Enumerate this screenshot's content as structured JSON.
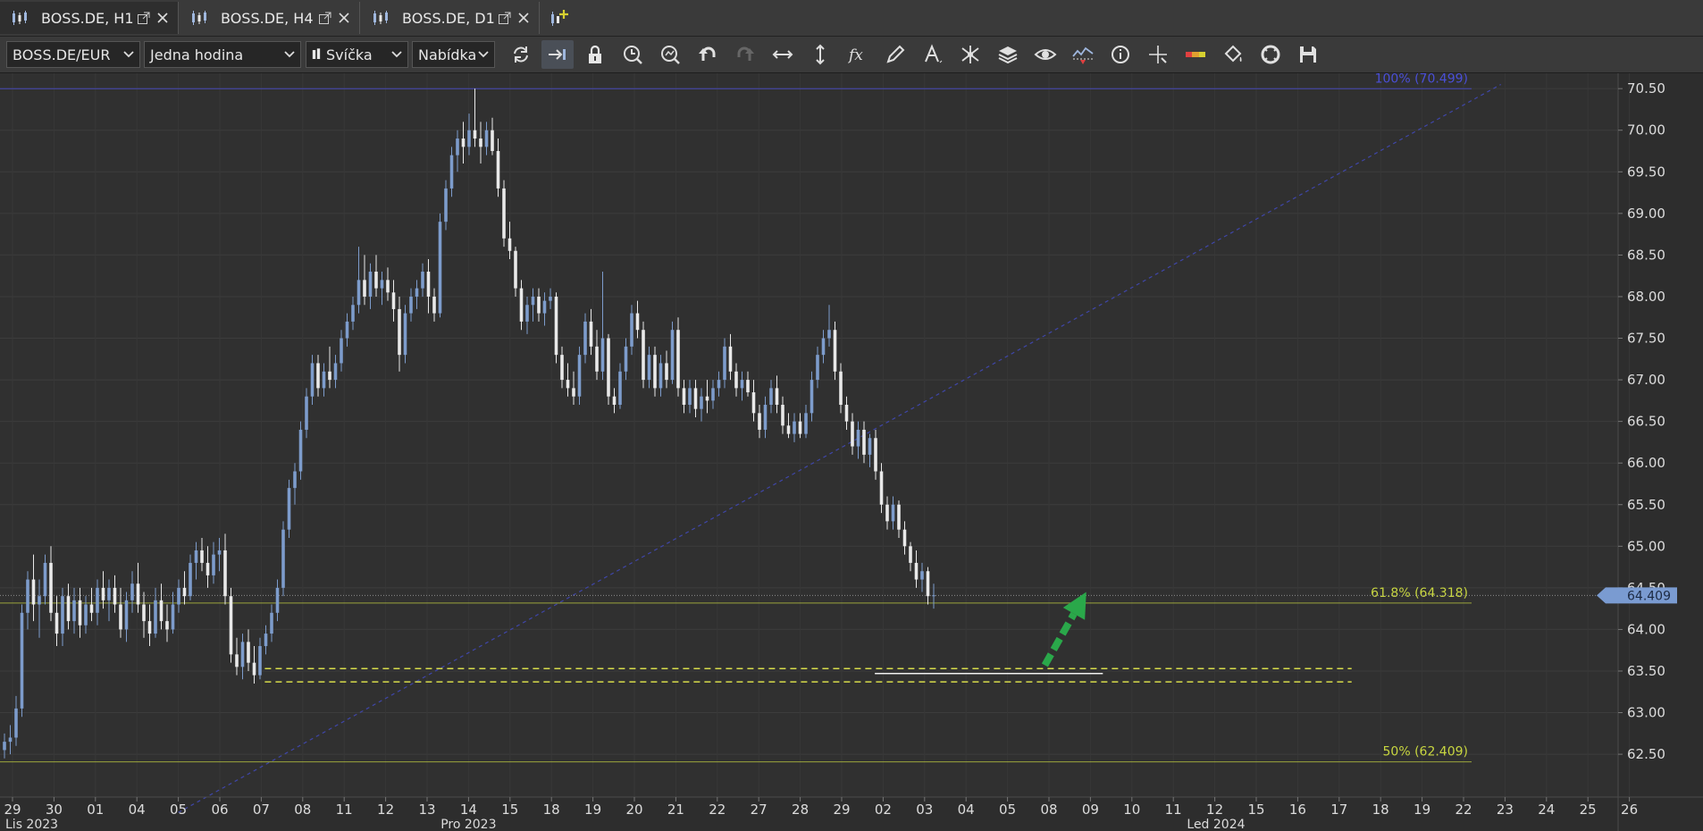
{
  "tabs": [
    {
      "label": "BOSS.DE, H1",
      "active": true
    },
    {
      "label": "BOSS.DE, H4",
      "active": false
    },
    {
      "label": "BOSS.DE, D1",
      "active": false
    }
  ],
  "toolbar": {
    "symbol": "BOSS.DE/EUR",
    "timeframe": "Jedna hodina",
    "chart_type": "Svíčka",
    "price_side": "Nabídka",
    "icons": [
      "refresh-icon",
      "auto-scroll-icon",
      "lock-icon",
      "zoom-time-icon",
      "zoom-fit-icon",
      "undo-icon",
      "redo-icon",
      "horizontal-scale-icon",
      "vertical-scale-icon",
      "indicator-fx-icon",
      "pencil-icon",
      "text-tool-icon",
      "drawing-tools-icon",
      "layers-icon",
      "eye-icon",
      "alert-icon",
      "info-icon",
      "crosshair-icon",
      "color-scale-icon",
      "paint-bucket-icon",
      "fullscreen-icon",
      "save-icon"
    ]
  },
  "colors": {
    "background": "#2d2d2d",
    "bull_candle": "#7d9ccc",
    "bear_candle": "#e9e9e9",
    "fib_100": "#4a4fd6",
    "fib_level": "#c8d640",
    "zone_line": "#d8dc4a",
    "arrow": "#2aa84a",
    "price_tag": "#7a9bd1"
  },
  "chart_data": {
    "type": "candlestick",
    "symbol": "BOSS.DE/EUR",
    "timeframe": "H1",
    "ylim": [
      62.05,
      70.62
    ],
    "y_ticks": [
      "70.50",
      "70.00",
      "69.50",
      "69.00",
      "68.50",
      "68.00",
      "67.50",
      "67.00",
      "66.50",
      "66.00",
      "65.50",
      "65.00",
      "64.50",
      "64.00",
      "63.50",
      "63.00",
      "62.50"
    ],
    "x_ticks": [
      "29",
      "30",
      "01",
      "04",
      "05",
      "06",
      "07",
      "08",
      "11",
      "12",
      "13",
      "14",
      "15",
      "18",
      "19",
      "20",
      "21",
      "22",
      "27",
      "28",
      "29",
      "02",
      "03",
      "04",
      "05",
      "08",
      "09",
      "10",
      "11",
      "12",
      "15",
      "16",
      "17",
      "18",
      "19",
      "22",
      "23",
      "24",
      "25",
      "26"
    ],
    "period_labels": [
      {
        "label": "Lis 2023",
        "at_tick": 0
      },
      {
        "label": "Pro 2023",
        "at_tick": 10.5
      },
      {
        "label": "Led 2024",
        "at_tick": 28.5
      }
    ],
    "current_price": "64.409",
    "fibonacci": [
      {
        "label": "100% (70.499)",
        "value": 70.499
      },
      {
        "label": "61.8% (64.318)",
        "value": 64.318
      },
      {
        "label": "50% (62.409)",
        "value": 62.409
      }
    ],
    "support_zone": {
      "upper": 63.53,
      "lower": 63.37,
      "from_tick": 6,
      "to_tick": 32.3
    },
    "support_line": {
      "value": 63.47,
      "from_tick": 20.8,
      "to_tick": 26.3
    },
    "trendline": {
      "from": {
        "tick": 4.0,
        "value": 61.8
      },
      "to": {
        "tick": 35.9,
        "value": 70.55
      }
    },
    "arrow": {
      "from": {
        "tick": 24.9,
        "value": 63.57
      },
      "to": {
        "tick": 25.9,
        "value": 64.45
      }
    },
    "candles": [
      [
        62.55,
        62.75,
        62.45,
        62.65
      ],
      [
        62.65,
        62.85,
        62.5,
        62.7
      ],
      [
        62.7,
        63.2,
        62.6,
        63.05
      ],
      [
        63.05,
        64.3,
        62.95,
        64.2
      ],
      [
        64.2,
        64.7,
        64.0,
        64.6
      ],
      [
        64.6,
        64.9,
        64.1,
        64.3
      ],
      [
        64.3,
        64.6,
        63.9,
        64.4
      ],
      [
        64.4,
        64.9,
        64.3,
        64.8
      ],
      [
        64.8,
        65.0,
        64.1,
        64.2
      ],
      [
        64.2,
        64.4,
        63.8,
        63.95
      ],
      [
        63.95,
        64.5,
        63.8,
        64.4
      ],
      [
        64.4,
        64.55,
        64.0,
        64.1
      ],
      [
        64.1,
        64.5,
        63.95,
        64.35
      ],
      [
        64.35,
        64.5,
        63.9,
        64.05
      ],
      [
        64.05,
        64.4,
        63.95,
        64.3
      ],
      [
        64.3,
        64.5,
        64.1,
        64.2
      ],
      [
        64.2,
        64.6,
        64.05,
        64.5
      ],
      [
        64.5,
        64.7,
        64.25,
        64.35
      ],
      [
        64.35,
        64.6,
        64.1,
        64.5
      ],
      [
        64.5,
        64.65,
        64.2,
        64.3
      ],
      [
        64.3,
        64.5,
        63.9,
        64.0
      ],
      [
        64.0,
        64.45,
        63.85,
        64.35
      ],
      [
        64.35,
        64.7,
        64.2,
        64.55
      ],
      [
        64.55,
        64.8,
        64.2,
        64.3
      ],
      [
        64.3,
        64.45,
        63.9,
        64.1
      ],
      [
        64.1,
        64.3,
        63.8,
        63.95
      ],
      [
        63.95,
        64.5,
        63.9,
        64.35
      ],
      [
        64.35,
        64.55,
        64.0,
        64.1
      ],
      [
        64.1,
        64.3,
        63.85,
        64.0
      ],
      [
        64.0,
        64.45,
        63.95,
        64.3
      ],
      [
        64.3,
        64.6,
        64.2,
        64.5
      ],
      [
        64.5,
        64.7,
        64.3,
        64.4
      ],
      [
        64.4,
        64.9,
        64.35,
        64.8
      ],
      [
        64.8,
        65.05,
        64.6,
        64.95
      ],
      [
        64.95,
        65.1,
        64.7,
        64.8
      ],
      [
        64.8,
        65.0,
        64.5,
        64.65
      ],
      [
        64.65,
        65.05,
        64.55,
        64.9
      ],
      [
        64.9,
        65.1,
        64.7,
        64.95
      ],
      [
        64.95,
        65.15,
        64.3,
        64.4
      ],
      [
        64.4,
        64.5,
        63.6,
        63.7
      ],
      [
        63.7,
        63.9,
        63.45,
        63.55
      ],
      [
        63.55,
        63.95,
        63.4,
        63.85
      ],
      [
        63.85,
        64.0,
        63.5,
        63.6
      ],
      [
        63.6,
        63.8,
        63.35,
        63.45
      ],
      [
        63.45,
        63.9,
        63.4,
        63.8
      ],
      [
        63.8,
        64.05,
        63.7,
        63.95
      ],
      [
        63.95,
        64.3,
        63.85,
        64.2
      ],
      [
        64.2,
        64.6,
        64.1,
        64.5
      ],
      [
        64.5,
        65.3,
        64.4,
        65.2
      ],
      [
        65.2,
        65.8,
        65.1,
        65.7
      ],
      [
        65.7,
        66.0,
        65.5,
        65.9
      ],
      [
        65.9,
        66.5,
        65.8,
        66.4
      ],
      [
        66.4,
        66.9,
        66.3,
        66.8
      ],
      [
        66.8,
        67.3,
        66.7,
        67.2
      ],
      [
        67.2,
        67.3,
        66.8,
        66.9
      ],
      [
        66.9,
        67.2,
        66.8,
        67.1
      ],
      [
        67.1,
        67.4,
        66.9,
        67.0
      ],
      [
        67.0,
        67.3,
        66.9,
        67.2
      ],
      [
        67.2,
        67.6,
        67.1,
        67.5
      ],
      [
        67.5,
        67.8,
        67.4,
        67.7
      ],
      [
        67.7,
        68.0,
        67.6,
        67.9
      ],
      [
        67.9,
        68.6,
        67.8,
        68.2
      ],
      [
        68.2,
        68.5,
        67.9,
        68.0
      ],
      [
        68.0,
        68.4,
        67.85,
        68.3
      ],
      [
        68.3,
        68.5,
        68.0,
        68.1
      ],
      [
        68.1,
        68.3,
        67.9,
        68.2
      ],
      [
        68.2,
        68.35,
        67.95,
        68.05
      ],
      [
        68.05,
        68.2,
        67.7,
        67.85
      ],
      [
        67.85,
        68.0,
        67.1,
        67.3
      ],
      [
        67.3,
        67.9,
        67.2,
        67.8
      ],
      [
        67.8,
        68.1,
        67.7,
        68.0
      ],
      [
        68.0,
        68.2,
        67.85,
        68.1
      ],
      [
        68.1,
        68.4,
        68.0,
        68.3
      ],
      [
        68.3,
        68.45,
        67.8,
        68.0
      ],
      [
        68.0,
        68.1,
        67.7,
        67.8
      ],
      [
        67.8,
        69.0,
        67.75,
        68.9
      ],
      [
        68.9,
        69.4,
        68.8,
        69.3
      ],
      [
        69.3,
        69.8,
        69.2,
        69.7
      ],
      [
        69.7,
        70.0,
        69.5,
        69.9
      ],
      [
        69.9,
        70.1,
        69.6,
        69.8
      ],
      [
        69.8,
        70.2,
        69.7,
        70.0
      ],
      [
        70.0,
        70.5,
        69.8,
        69.9
      ],
      [
        69.9,
        70.1,
        69.6,
        69.8
      ],
      [
        69.8,
        70.1,
        69.7,
        70.0
      ],
      [
        70.0,
        70.15,
        69.7,
        69.75
      ],
      [
        69.75,
        69.9,
        69.2,
        69.3
      ],
      [
        69.3,
        69.4,
        68.6,
        68.7
      ],
      [
        68.7,
        68.9,
        68.45,
        68.55
      ],
      [
        68.55,
        68.6,
        68.0,
        68.1
      ],
      [
        68.1,
        68.2,
        67.6,
        67.7
      ],
      [
        67.7,
        68.0,
        67.55,
        67.9
      ],
      [
        67.9,
        68.1,
        67.7,
        68.0
      ],
      [
        68.0,
        68.1,
        67.7,
        67.8
      ],
      [
        67.8,
        68.05,
        67.65,
        67.95
      ],
      [
        67.95,
        68.1,
        67.85,
        68.0
      ],
      [
        68.0,
        68.05,
        67.2,
        67.3
      ],
      [
        67.3,
        67.4,
        66.9,
        67.0
      ],
      [
        67.0,
        67.2,
        66.8,
        66.9
      ],
      [
        66.9,
        67.1,
        66.7,
        66.8
      ],
      [
        66.8,
        67.4,
        66.7,
        67.3
      ],
      [
        67.3,
        67.8,
        67.2,
        67.7
      ],
      [
        67.7,
        67.85,
        67.3,
        67.4
      ],
      [
        67.4,
        67.6,
        67.0,
        67.1
      ],
      [
        67.1,
        68.3,
        67.0,
        67.5
      ],
      [
        67.5,
        67.55,
        66.7,
        66.8
      ],
      [
        66.8,
        66.9,
        66.6,
        66.7
      ],
      [
        66.7,
        67.2,
        66.65,
        67.1
      ],
      [
        67.1,
        67.5,
        67.0,
        67.4
      ],
      [
        67.4,
        67.9,
        67.3,
        67.8
      ],
      [
        67.8,
        67.95,
        67.5,
        67.6
      ],
      [
        67.6,
        67.7,
        66.9,
        67.0
      ],
      [
        67.0,
        67.4,
        66.9,
        67.3
      ],
      [
        67.3,
        67.4,
        66.8,
        66.9
      ],
      [
        66.9,
        67.3,
        66.8,
        67.2
      ],
      [
        67.2,
        67.35,
        66.9,
        67.0
      ],
      [
        67.0,
        67.7,
        66.95,
        67.6
      ],
      [
        67.6,
        67.75,
        66.8,
        66.9
      ],
      [
        66.9,
        67.0,
        66.6,
        66.7
      ],
      [
        66.7,
        67.0,
        66.6,
        66.9
      ],
      [
        66.9,
        67.0,
        66.55,
        66.65
      ],
      [
        66.65,
        66.9,
        66.5,
        66.8
      ],
      [
        66.8,
        67.0,
        66.6,
        66.75
      ],
      [
        66.75,
        67.0,
        66.65,
        66.9
      ],
      [
        66.9,
        67.1,
        66.8,
        67.0
      ],
      [
        67.0,
        67.5,
        66.9,
        67.4
      ],
      [
        67.4,
        67.55,
        67.0,
        67.1
      ],
      [
        67.1,
        67.2,
        66.8,
        66.9
      ],
      [
        66.9,
        67.1,
        66.75,
        67.0
      ],
      [
        67.0,
        67.1,
        66.8,
        66.85
      ],
      [
        66.85,
        67.0,
        66.5,
        66.6
      ],
      [
        66.6,
        66.7,
        66.3,
        66.4
      ],
      [
        66.4,
        66.8,
        66.3,
        66.7
      ],
      [
        66.7,
        67.0,
        66.6,
        66.9
      ],
      [
        66.9,
        67.05,
        66.6,
        66.7
      ],
      [
        66.7,
        66.8,
        66.35,
        66.45
      ],
      [
        66.45,
        66.6,
        66.3,
        66.35
      ],
      [
        66.35,
        66.6,
        66.25,
        66.5
      ],
      [
        66.5,
        66.6,
        66.3,
        66.35
      ],
      [
        66.35,
        66.7,
        66.3,
        66.6
      ],
      [
        66.6,
        67.1,
        66.5,
        67.0
      ],
      [
        67.0,
        67.4,
        66.9,
        67.3
      ],
      [
        67.3,
        67.6,
        67.2,
        67.5
      ],
      [
        67.5,
        67.9,
        67.4,
        67.6
      ],
      [
        67.6,
        67.7,
        67.0,
        67.1
      ],
      [
        67.1,
        67.2,
        66.6,
        66.7
      ],
      [
        66.7,
        66.8,
        66.4,
        66.5
      ],
      [
        66.5,
        66.6,
        66.1,
        66.2
      ],
      [
        66.2,
        66.5,
        66.05,
        66.4
      ],
      [
        66.4,
        66.5,
        66.0,
        66.1
      ],
      [
        66.1,
        66.35,
        65.95,
        66.3
      ],
      [
        66.3,
        66.4,
        65.8,
        65.9
      ],
      [
        65.9,
        66.0,
        65.4,
        65.5
      ],
      [
        65.5,
        65.6,
        65.2,
        65.3
      ],
      [
        65.3,
        65.6,
        65.2,
        65.5
      ],
      [
        65.5,
        65.55,
        65.1,
        65.2
      ],
      [
        65.2,
        65.3,
        64.9,
        65.0
      ],
      [
        65.0,
        65.05,
        64.7,
        64.8
      ],
      [
        64.8,
        64.95,
        64.5,
        64.6
      ],
      [
        64.6,
        64.8,
        64.45,
        64.7
      ],
      [
        64.7,
        64.75,
        64.3,
        64.4
      ],
      [
        64.4,
        64.55,
        64.25,
        64.41
      ]
    ]
  }
}
